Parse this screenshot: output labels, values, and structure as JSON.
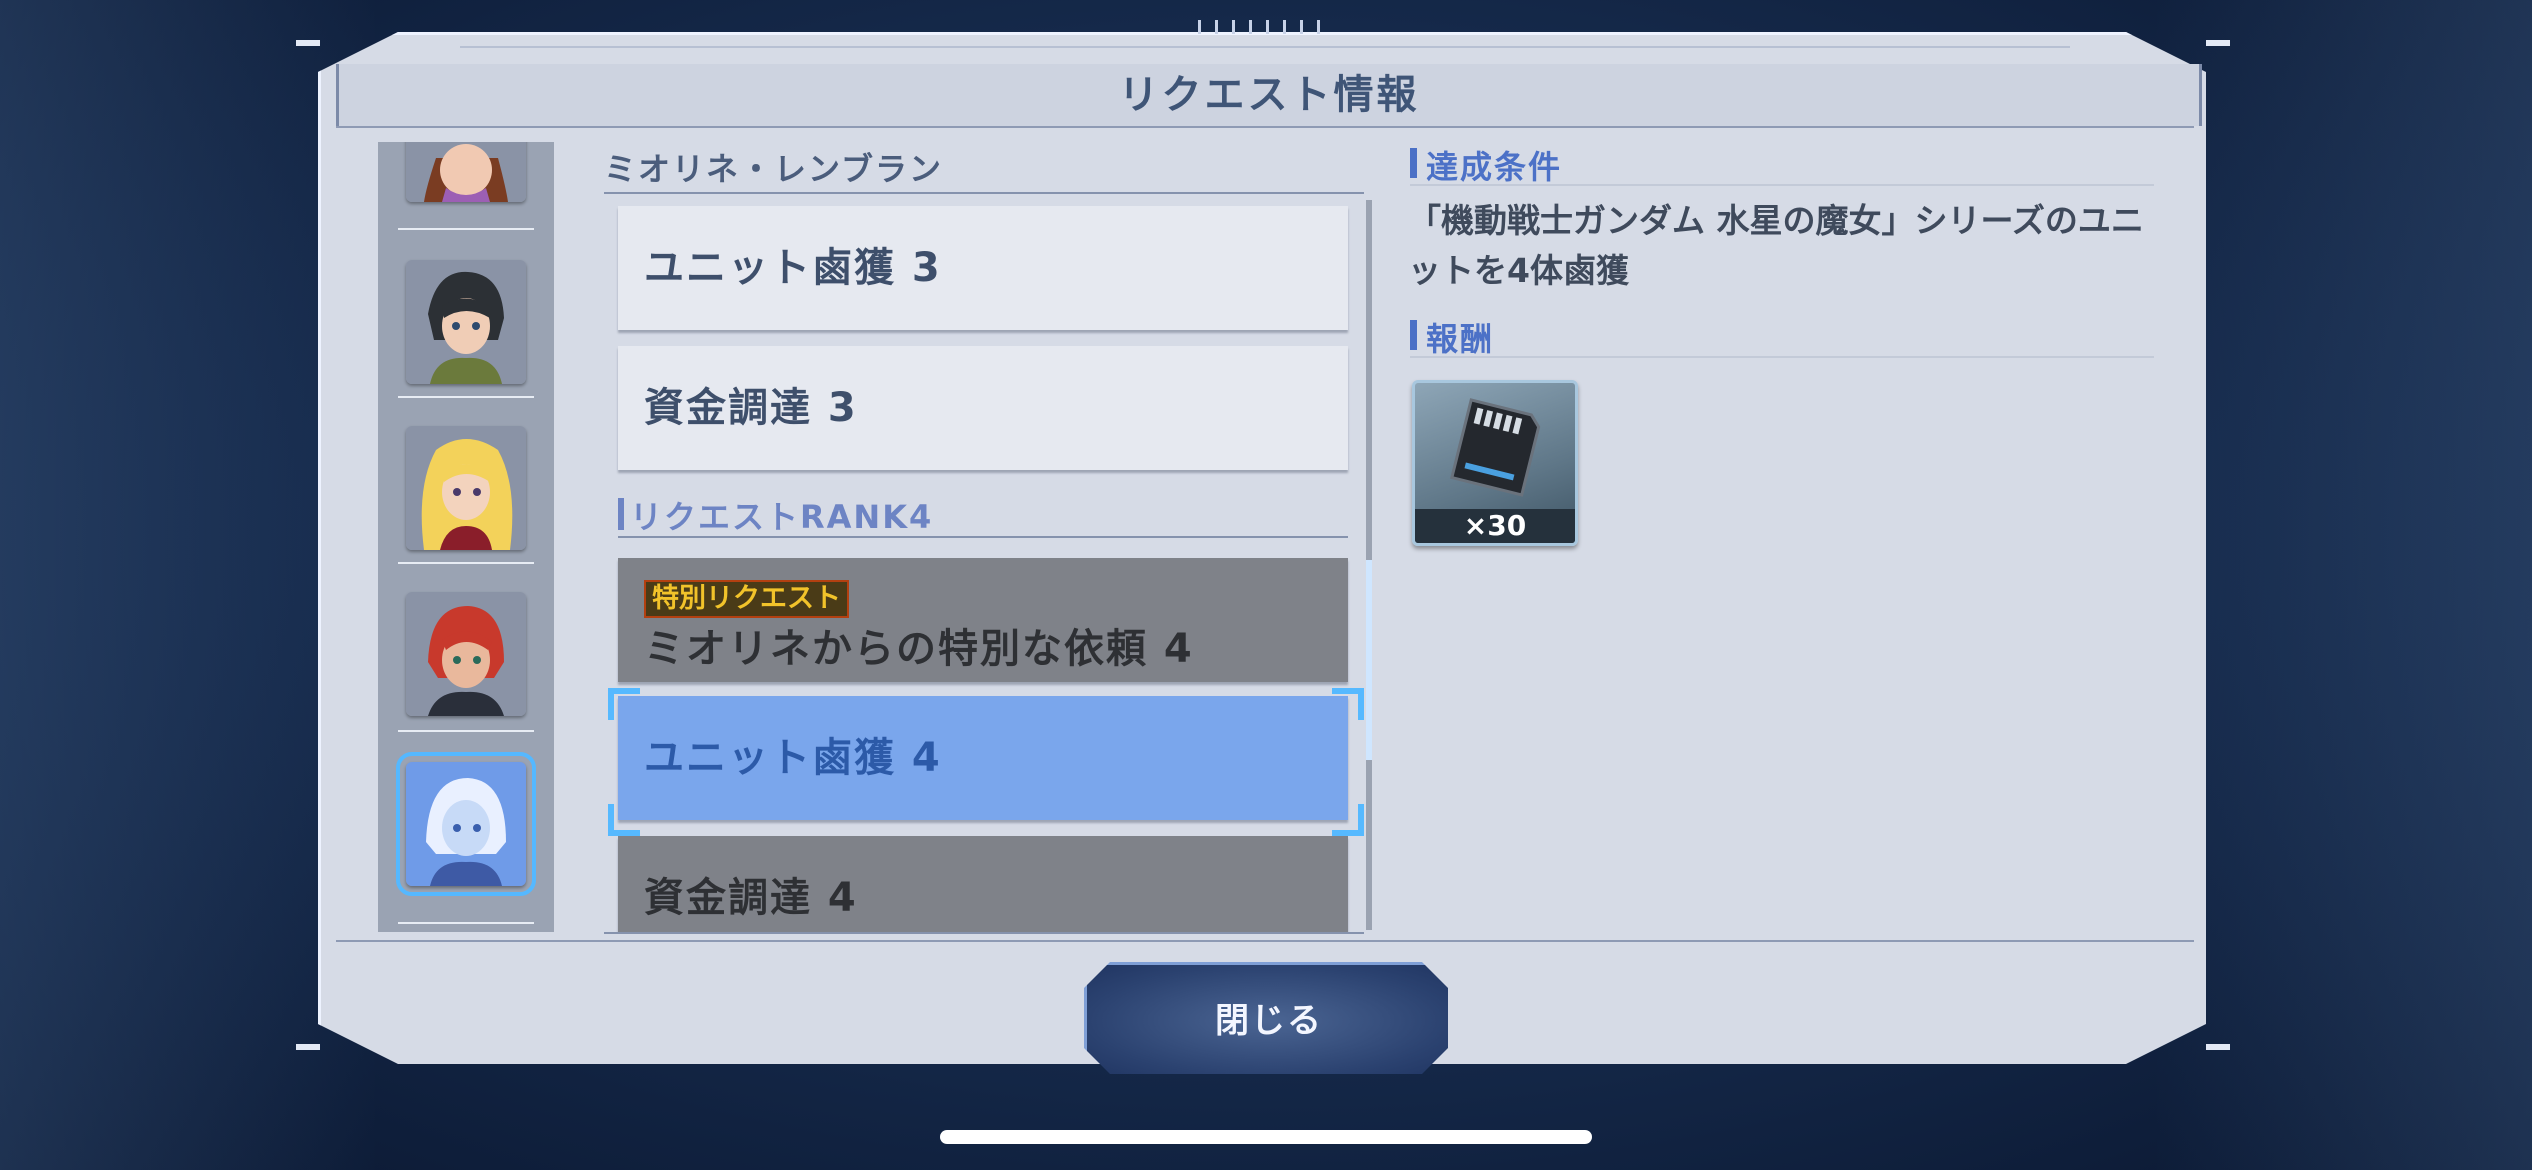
{
  "dialog": {
    "title": "リクエスト情報",
    "close_label": "閉じる"
  },
  "characters": [
    {
      "name": "brown-hair-character",
      "selected": false
    },
    {
      "name": "dark-hair-character",
      "selected": false
    },
    {
      "name": "blonde-character",
      "selected": false
    },
    {
      "name": "red-hair-character",
      "selected": false
    },
    {
      "name": "white-hair-character",
      "selected": true
    }
  ],
  "request_list": {
    "character_name": "ミオリネ・レンブラン",
    "items_rank3": [
      {
        "label": "ユニット鹵獲 3"
      },
      {
        "label": "資金調達 3"
      }
    ],
    "rank4_header": "リクエストRANK4",
    "special": {
      "tag": "特別リクエスト",
      "label": "ミオリネからの特別な依頼 4"
    },
    "items_rank4": [
      {
        "label": "ユニット鹵獲 4",
        "selected": true
      },
      {
        "label": "資金調達 4",
        "selected": false
      }
    ]
  },
  "detail": {
    "condition_header": "達成条件",
    "condition_text": "「機動戦士ガンダム 水星の魔女」シリーズのユニットを4体鹵獲",
    "reward_header": "報酬",
    "reward": {
      "icon": "memory-card-icon",
      "count": "×30"
    }
  },
  "colors": {
    "accent": "#4b70c6",
    "selection": "#7aa6ec",
    "panel": "#d6dbe6"
  }
}
